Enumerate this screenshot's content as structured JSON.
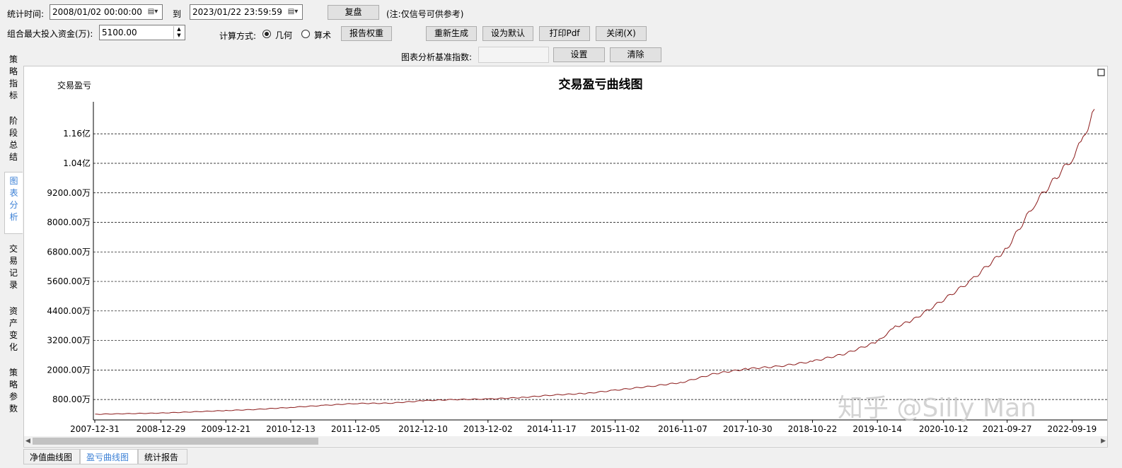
{
  "toolbar": {
    "stat_time_label": "统计时间:",
    "start_time": "2008/01/02 00:00:00",
    "to_label": "到",
    "end_time": "2023/01/22 23:59:59",
    "replay_button": "复盘",
    "note": "(注:仅信号可供参考)",
    "max_capital_label": "组合最大投入资金(万):",
    "max_capital_value": "5100.00",
    "calc_method_label": "计算方式:",
    "radio_geometric": "几何",
    "radio_arithmetic": "算术",
    "report_weight_button": "报告权重",
    "regenerate_button": "重新生成",
    "set_default_button": "设为默认",
    "print_pdf_button": "打印Pdf",
    "close_button": "关闭(X)",
    "benchmark_label": "图表分析基准指数:",
    "benchmark_value": "",
    "set_button": "设置",
    "clear_button": "清除"
  },
  "side_tabs": [
    {
      "label": "策略指标",
      "active": false
    },
    {
      "label": "阶段总结",
      "active": false
    },
    {
      "label": "图表分析",
      "active": true
    },
    {
      "label": "交易记录",
      "active": false
    },
    {
      "label": "资产变化",
      "active": false
    },
    {
      "label": "策略参数",
      "active": false
    }
  ],
  "bottom_tabs": [
    {
      "label": "净值曲线图",
      "active": false
    },
    {
      "label": "盈亏曲线图",
      "active": true
    },
    {
      "label": "统计报告",
      "active": false
    }
  ],
  "watermark": "知乎 @Silly Man",
  "chart_data": {
    "type": "line",
    "title": "交易盈亏曲线图",
    "ylabel": "交易盈亏",
    "xlabel": "",
    "y_unit": "万",
    "yticks": [
      {
        "value": 800,
        "label": "800.00万"
      },
      {
        "value": 2000,
        "label": "2000.00万"
      },
      {
        "value": 3200,
        "label": "3200.00万"
      },
      {
        "value": 4400,
        "label": "4400.00万"
      },
      {
        "value": 5600,
        "label": "5600.00万"
      },
      {
        "value": 6800,
        "label": "6800.00万"
      },
      {
        "value": 8000,
        "label": "8000.00万"
      },
      {
        "value": 9200,
        "label": "9200.00万"
      },
      {
        "value": 10400,
        "label": "1.04亿"
      },
      {
        "value": 11600,
        "label": "1.16亿"
      }
    ],
    "ylim": [
      -30,
      12900
    ],
    "xlim": [
      "2007-12-31",
      "2023-01-20"
    ],
    "xticks": [
      "2007-12-31",
      "2008-12-29",
      "2009-12-21",
      "2010-12-13",
      "2011-12-05",
      "2012-12-10",
      "2013-12-02",
      "2014-11-17",
      "2015-11-02",
      "2016-11-07",
      "2017-10-30",
      "2018-10-22",
      "2019-10-14",
      "2020-10-12",
      "2021-09-27",
      "2022-09-19"
    ],
    "grid": true,
    "color": "#8b1a1a",
    "series": [
      {
        "x": [
          "2008-01-02",
          "2008-12-29",
          "2009-12-21",
          "2010-06-15",
          "2010-12-13",
          "2011-06-10",
          "2011-12-05",
          "2012-06-10",
          "2012-12-10",
          "2013-06-05",
          "2013-12-02",
          "2014-06-05",
          "2014-11-17",
          "2015-06-01",
          "2015-11-02",
          "2016-06-01",
          "2016-11-07",
          "2017-05-01",
          "2017-10-30",
          "2018-04-25",
          "2018-10-22",
          "2019-04-15",
          "2019-10-14",
          "2020-01-20",
          "2020-04-20",
          "2020-10-12",
          "2021-03-15",
          "2021-09-27",
          "2022-03-01",
          "2022-09-19",
          "2022-11-20",
          "2023-01-20"
        ],
        "y": [
          200,
          250,
          350,
          400,
          480,
          560,
          640,
          650,
          750,
          800,
          820,
          880,
          980,
          1050,
          1180,
          1350,
          1500,
          1850,
          2050,
          2150,
          2350,
          2650,
          3150,
          3750,
          4000,
          4850,
          5650,
          6950,
          8800,
          10600,
          11400,
          12600
        ]
      }
    ]
  }
}
